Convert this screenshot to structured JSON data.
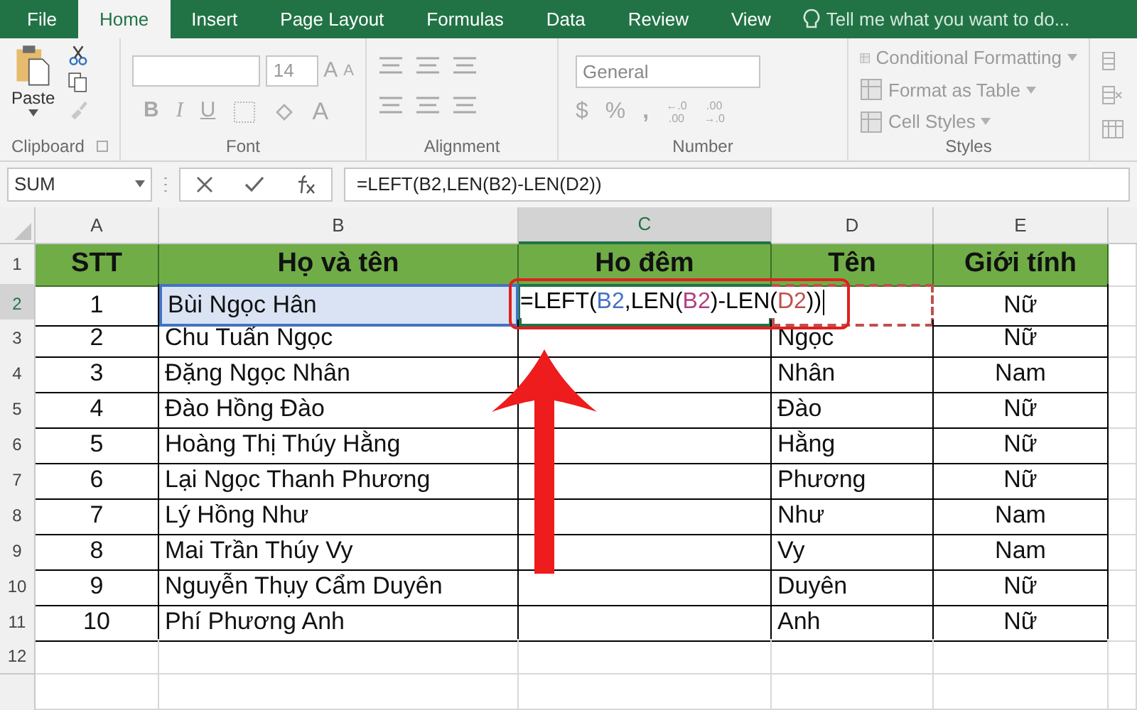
{
  "tabs": [
    {
      "label": "File",
      "selected": false
    },
    {
      "label": "Home",
      "selected": true
    },
    {
      "label": "Insert",
      "selected": false
    },
    {
      "label": "Page Layout",
      "selected": false
    },
    {
      "label": "Formulas",
      "selected": false
    },
    {
      "label": "Data",
      "selected": false
    },
    {
      "label": "Review",
      "selected": false
    },
    {
      "label": "View",
      "selected": false
    }
  ],
  "tell_me": "Tell me what you want to do...",
  "clipboard": {
    "paste": "Paste",
    "label": "Clipboard"
  },
  "font": {
    "size": "14",
    "bold": "B",
    "italic": "I",
    "underline": "U",
    "grow": "A",
    "shrink": "A",
    "font_color": "A",
    "label": "Font"
  },
  "alignment": {
    "label": "Alignment"
  },
  "number": {
    "format": "General",
    "currency": "$",
    "percent": "%",
    "comma": ",",
    "increase_decimal": [
      "←.0",
      ".00"
    ],
    "decrease_decimal": [
      ".00",
      "→.0"
    ],
    "label": "Number"
  },
  "styles": {
    "items": [
      "Conditional Formatting",
      "Format as Table",
      "Cell Styles"
    ],
    "label": "Styles"
  },
  "formula_bar": {
    "name_box": "SUM",
    "formula": "=LEFT(B2,LEN(B2)-LEN(D2))"
  },
  "columns": [
    {
      "label": "A",
      "selected": false
    },
    {
      "label": "B",
      "selected": false
    },
    {
      "label": "C",
      "selected": true
    },
    {
      "label": "D",
      "selected": false
    },
    {
      "label": "E",
      "selected": false
    }
  ],
  "header": {
    "number": "1",
    "stt": "STT",
    "full_name": "Họ và tên",
    "middle_name": "Ho đêm",
    "first_name": "Tên",
    "gender": "Giới tính"
  },
  "rows": [
    {
      "number": "2",
      "stt": "1",
      "full_name": "Bùi Ngọc Hân",
      "gender": "Nữ",
      "formula": [
        {
          "text": "=LEFT(",
          "color": "#000000"
        },
        {
          "text": "B2",
          "color": "#4472c4"
        },
        {
          "text": ",LEN(",
          "color": "#000000"
        },
        {
          "text": "B2",
          "color": "#b04080"
        },
        {
          "text": ")-LEN(",
          "color": "#000000"
        },
        {
          "text": "D2",
          "color": "#c0504d"
        },
        {
          "text": "))",
          "color": "#000000"
        }
      ]
    },
    {
      "number": "3",
      "stt": "2",
      "full_name": "Chu Tuấn Ngọc",
      "first_name": "Ngọc",
      "gender": "Nữ"
    },
    {
      "number": "4",
      "stt": "3",
      "full_name": "Đặng Ngọc Nhân",
      "first_name": "Nhân",
      "gender": "Nam"
    },
    {
      "number": "5",
      "stt": "4",
      "full_name": "Đào Hồng Đào",
      "first_name": "Đào",
      "gender": "Nữ"
    },
    {
      "number": "6",
      "stt": "5",
      "full_name": "Hoàng Thị Thúy Hằng",
      "first_name": "Hằng",
      "gender": "Nữ"
    },
    {
      "number": "7",
      "stt": "6",
      "full_name": "Lại Ngọc Thanh Phương",
      "first_name": "Phương",
      "gender": "Nữ"
    },
    {
      "number": "8",
      "stt": "7",
      "full_name": "Lý Hồng Như",
      "first_name": "Như",
      "gender": "Nam"
    },
    {
      "number": "9",
      "stt": "8",
      "full_name": "Mai Trần Thúy Vy",
      "first_name": "Vy",
      "gender": "Nam"
    },
    {
      "number": "10",
      "stt": "9",
      "full_name": "Nguyễn Thụy Cẩm Duyên",
      "first_name": "Duyên",
      "gender": "Nữ"
    },
    {
      "number": "11",
      "stt": "10",
      "full_name": "Phí Phương Anh",
      "first_name": "Anh",
      "gender": "Nữ"
    }
  ],
  "empty_rows": [
    "12"
  ]
}
